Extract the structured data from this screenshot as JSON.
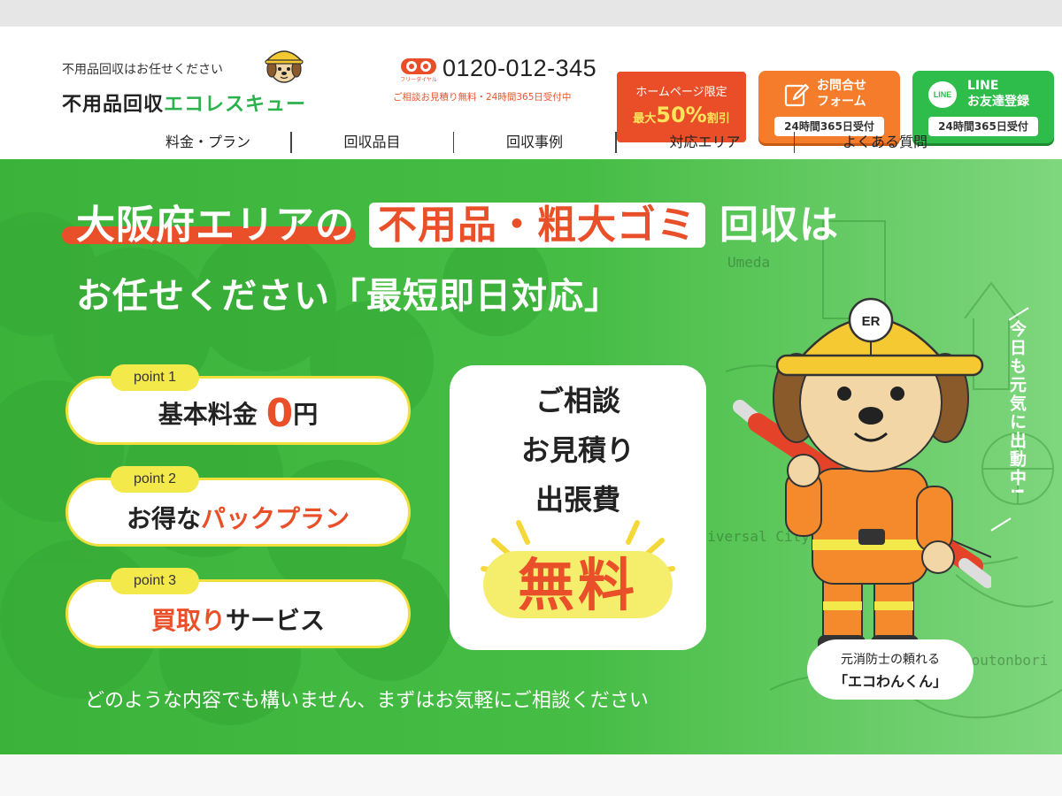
{
  "header": {
    "tagline": "不用品回収はお任せください",
    "logo_main": "不用品回収",
    "logo_accent": "エコレスキュー",
    "freedial_label": "フリーダイヤル",
    "phone_number": "0120-012-345",
    "phone_note": "ご相談お見積り無料・24時間365日受付中",
    "promo": {
      "line1": "ホームページ限定",
      "prefix": "最大",
      "big": "50%",
      "suffix": "割引"
    },
    "cta_form": {
      "title1": "お問合せ",
      "title2": "フォーム",
      "pill": "24時間365日受付"
    },
    "cta_line": {
      "badge": "LINE",
      "title1": "LINE",
      "title2": "お友達登録",
      "pill": "24時間365日受付"
    }
  },
  "nav": {
    "items": [
      "料金・プラン",
      "回収品目",
      "回収事例",
      "対応エリア",
      "よくある質問"
    ]
  },
  "hero": {
    "headline1_a": "大阪府エリアの",
    "headline1_b": "不用品・粗大ゴミ",
    "headline1_c": "回収は",
    "headline2": "お任せください「最短即日対応」",
    "points": [
      {
        "tag": "point 1",
        "text_a": "基本料金",
        "text_b": "0",
        "text_c": "円"
      },
      {
        "tag": "point 2",
        "text_a": "お得な",
        "text_b": "パックプラン"
      },
      {
        "tag": "point 3",
        "text_a": "買取り",
        "text_b": "サービス"
      }
    ],
    "free_card": {
      "lines": [
        "ご相談",
        "お見積り",
        "出張費"
      ],
      "big": "無料"
    },
    "footer_message": "どのような内容でも構いません、まずはお気軽にご相談ください",
    "mascot": {
      "helmet_badge": "ER",
      "caption1": "元消防士の頼れる",
      "caption2": "「エコわんくん」"
    },
    "vertical_text": "今日も元気に出動中!",
    "map_labels": [
      "Umeda",
      "Universal City",
      "Doutonbori"
    ]
  },
  "colors": {
    "green": "#3bb33a",
    "orange": "#e9502a",
    "yellow": "#f4e94a",
    "cta_orange": "#f57c2a",
    "cta_green": "#2ebd4a"
  }
}
